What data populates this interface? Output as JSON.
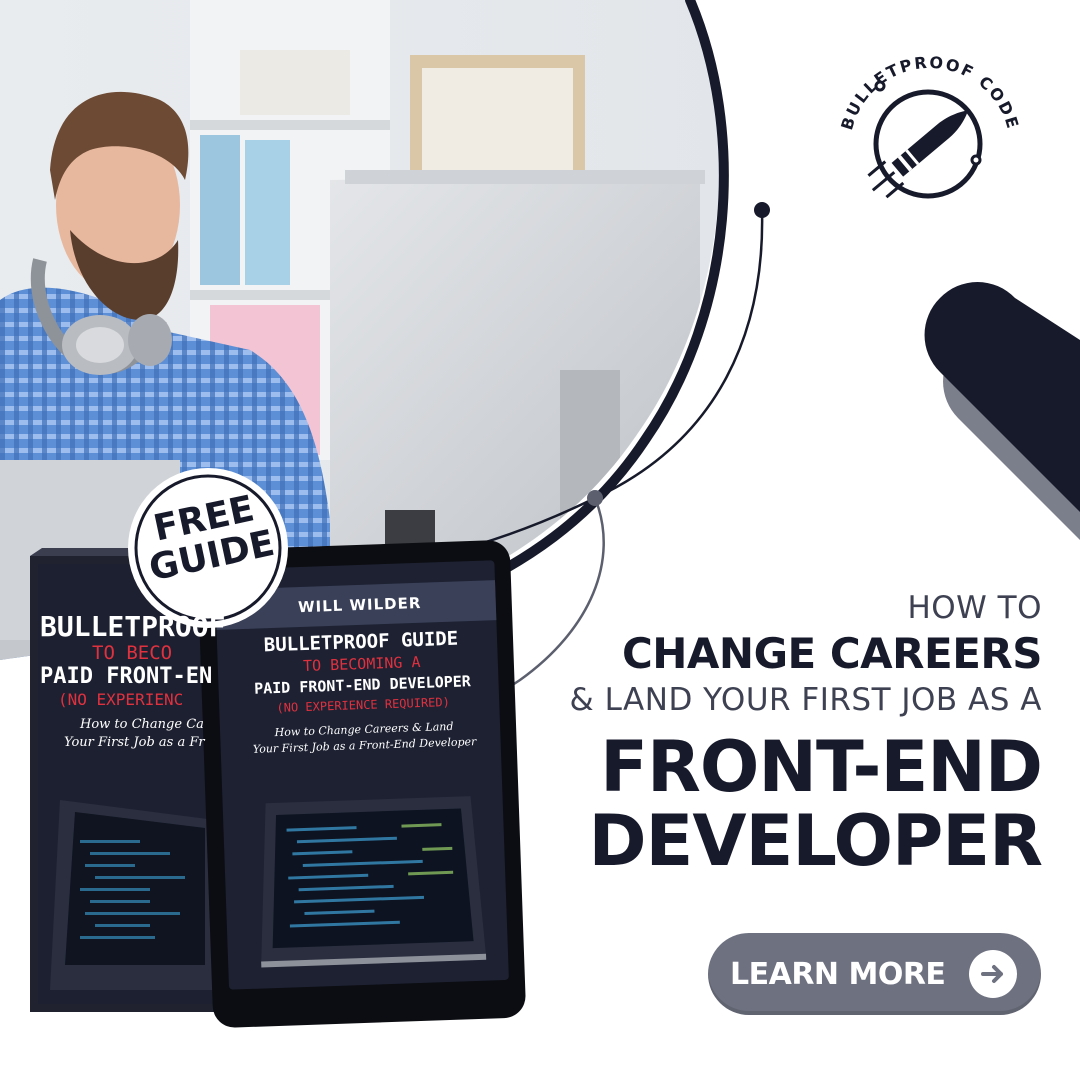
{
  "brand": {
    "name": "BULLETPROOF CODE"
  },
  "badge": {
    "line1": "FREE",
    "line2": "GUIDE"
  },
  "book": {
    "author": "WILL WILDER",
    "title_line1": "BULLETPROOF GUIDE",
    "title_line2": "TO BECOMING A",
    "title_line3": "PAID FRONT-END DEVELOPER",
    "title_line4": "(NO EXPERIENCE REQUIRED)",
    "subtitle_line1": "How to Change Careers & Land",
    "subtitle_line2": "Your First Job as a Front-End Developer",
    "back_title_line1": "BULLETPROOF",
    "back_title_line2": "TO BECO",
    "back_title_line3": "PAID FRONT-EN",
    "back_title_line4": "(NO EXPERIENC",
    "back_subtitle_line1": "How to Change Ca",
    "back_subtitle_line2": "Your First Job as a Fr"
  },
  "headline": {
    "line1": "HOW TO",
    "line2": "CHANGE CAREERS",
    "line3": "& LAND YOUR FIRST JOB AS A",
    "line4": "FRONT-END",
    "line5": "DEVELOPER"
  },
  "cta": {
    "label": "LEARN MORE",
    "icon": "arrow-right-icon"
  },
  "colors": {
    "navy": "#171a2b",
    "gray": "#6e7180",
    "accent_red": "#c8102e"
  }
}
